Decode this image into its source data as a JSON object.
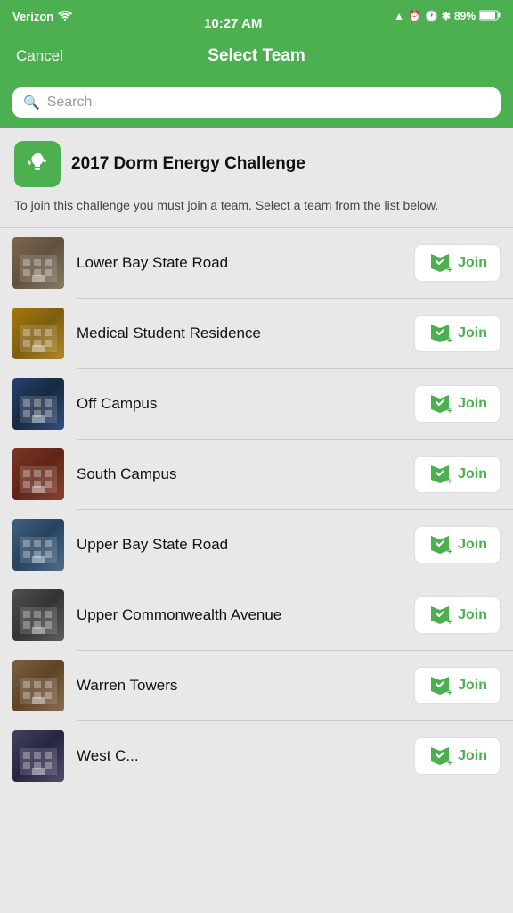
{
  "statusBar": {
    "carrier": "Verizon",
    "time": "10:27 AM",
    "battery": "89%",
    "batteryIcon": "🔋",
    "bluetoothIcon": "B",
    "alarmIcon": "⏰",
    "locationIcon": "▲"
  },
  "navigation": {
    "cancelLabel": "Cancel",
    "title": "Select Team"
  },
  "search": {
    "placeholder": "Search"
  },
  "challenge": {
    "title": "2017 Dorm Energy Challenge",
    "description": "To join this challenge you must join a team. Select a team from the list below."
  },
  "teams": [
    {
      "name": "Lower Bay State Road",
      "imgClass": "img-1"
    },
    {
      "name": "Medical Student Residence",
      "imgClass": "img-2"
    },
    {
      "name": "Off Campus",
      "imgClass": "img-3"
    },
    {
      "name": "South Campus",
      "imgClass": "img-4"
    },
    {
      "name": "Upper Bay State Road",
      "imgClass": "img-5"
    },
    {
      "name": "Upper Commonwealth Avenue",
      "imgClass": "img-6"
    },
    {
      "name": "Warren Towers",
      "imgClass": "img-7"
    },
    {
      "name": "West C...",
      "imgClass": "img-8"
    }
  ],
  "joinLabel": "Join"
}
